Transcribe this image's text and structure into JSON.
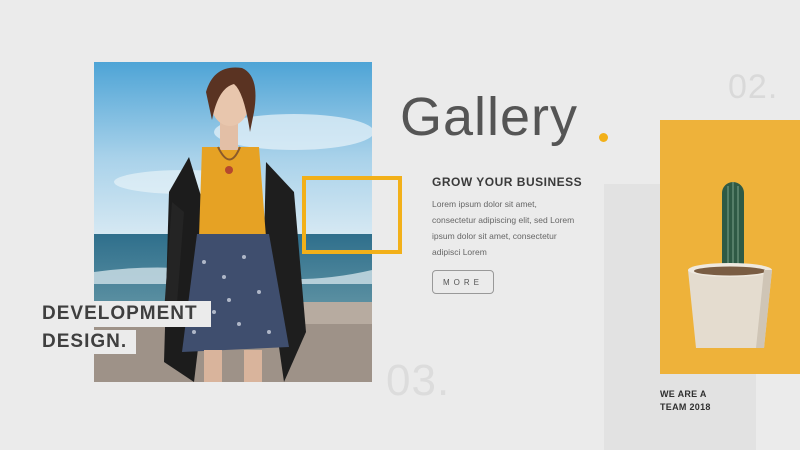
{
  "slide": {
    "title": "Gallery",
    "subtitle": "GROW YOUR BUSINESS",
    "body_lines": [
      "Lorem ipsum dolor sit amet,",
      "consectetur adipiscing elit, sed Lorem",
      "ipsum dolor sit amet, consectetur",
      "adipisci Lorem"
    ],
    "more_button": "MORE",
    "number_top": "02.",
    "number_bottom": "03.",
    "label_line1": "DEVELOPMENT",
    "label_line2": "DESIGN.",
    "team_line1": "WE ARE A",
    "team_line2": "TEAM 2018"
  },
  "colors": {
    "accent": "#f2b019",
    "panel_yellow": "#eeb23a",
    "background": "#ebebeb",
    "text_dark": "#3a3a3a"
  },
  "images": {
    "photo": "woman-on-beach-photo",
    "cactus": "potted-cactus-image"
  }
}
